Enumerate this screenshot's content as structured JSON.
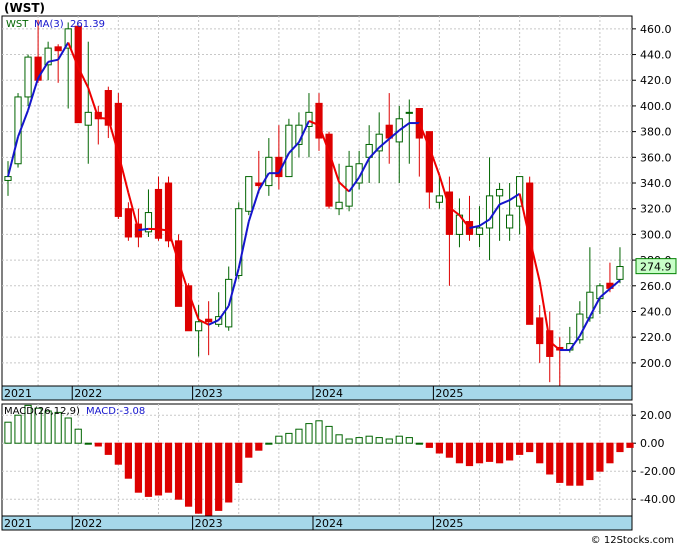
{
  "header": {
    "title": "(WST)"
  },
  "footer": {
    "credit": "© 12Stocks.com"
  },
  "colors": {
    "up": "#006400",
    "down": "#dd0000",
    "ma": "#1515cc",
    "ma_red": "#ee0000",
    "axis_band": "#a6d8ea",
    "grid": "#c8c8c8",
    "price_box": "#c8ffc8"
  },
  "chart_data": [
    {
      "type": "candlestick",
      "legend": {
        "ticker": "WST",
        "ma_label": "MA(3)",
        "ma_value": "261.39"
      },
      "last_price": "274.9",
      "ylim": [
        182,
        470
      ],
      "yticks": [
        "460.0",
        "440.0",
        "420.0",
        "400.0",
        "380.0",
        "360.0",
        "340.0",
        "320.0",
        "300.0",
        "280.0",
        "260.0",
        "240.0",
        "220.0",
        "200.0"
      ],
      "x_years": [
        {
          "label": "2021",
          "index": 0
        },
        {
          "label": "2022",
          "index": 7
        },
        {
          "label": "2023",
          "index": 19
        },
        {
          "label": "2024",
          "index": 31
        },
        {
          "label": "2025",
          "index": 43
        }
      ],
      "grid": true,
      "candles": [
        [
          342,
          357,
          330,
          345
        ],
        [
          355,
          410,
          352,
          407
        ],
        [
          407,
          440,
          400,
          438
        ],
        [
          438,
          467,
          418,
          420
        ],
        [
          432,
          450,
          420,
          445
        ],
        [
          446,
          448,
          418,
          443
        ],
        [
          445,
          465,
          398,
          460
        ],
        [
          462,
          462,
          395,
          387
        ],
        [
          385,
          450,
          355,
          395
        ],
        [
          395,
          400,
          370,
          390
        ],
        [
          412,
          415,
          375,
          385
        ],
        [
          402,
          410,
          312,
          314
        ],
        [
          320,
          325,
          295,
          298
        ],
        [
          308,
          320,
          290,
          298
        ],
        [
          302,
          335,
          298,
          317
        ],
        [
          335,
          345,
          295,
          297
        ],
        [
          340,
          345,
          290,
          295
        ],
        [
          295,
          300,
          245,
          244
        ],
        [
          260,
          262,
          225,
          225
        ],
        [
          225,
          245,
          205,
          232
        ],
        [
          234,
          248,
          206,
          232
        ],
        [
          230,
          255,
          228,
          236
        ],
        [
          228,
          275,
          225,
          265
        ],
        [
          268,
          325,
          265,
          320
        ],
        [
          318,
          345,
          315,
          345
        ],
        [
          340,
          365,
          332,
          338
        ],
        [
          338,
          375,
          330,
          360
        ],
        [
          360,
          385,
          335,
          345
        ],
        [
          345,
          390,
          345,
          385
        ],
        [
          370,
          395,
          360,
          385
        ],
        [
          384,
          410,
          360,
          395
        ],
        [
          402,
          410,
          365,
          375
        ],
        [
          378,
          380,
          320,
          322
        ],
        [
          320,
          355,
          315,
          325
        ],
        [
          322,
          365,
          318,
          353
        ],
        [
          340,
          365,
          335,
          355
        ],
        [
          360,
          385,
          340,
          370
        ],
        [
          365,
          395,
          340,
          378
        ],
        [
          385,
          410,
          355,
          375
        ],
        [
          372,
          400,
          340,
          390
        ],
        [
          395,
          405,
          355,
          395
        ],
        [
          398,
          395,
          345,
          375
        ],
        [
          380,
          365,
          320,
          333
        ],
        [
          325,
          345,
          320,
          330
        ],
        [
          333,
          345,
          260,
          300
        ],
        [
          300,
          328,
          290,
          315
        ],
        [
          310,
          330,
          295,
          300
        ],
        [
          300,
          322,
          290,
          305
        ],
        [
          305,
          360,
          280,
          330
        ],
        [
          330,
          340,
          295,
          335
        ],
        [
          305,
          340,
          295,
          315
        ],
        [
          322,
          338,
          300,
          345
        ],
        [
          340,
          345,
          240,
          230
        ],
        [
          235,
          245,
          200,
          215
        ],
        [
          225,
          240,
          185,
          205
        ],
        [
          212,
          220,
          180,
          210
        ],
        [
          210,
          228,
          208,
          215
        ],
        [
          218,
          248,
          215,
          238
        ],
        [
          235,
          290,
          232,
          255
        ],
        [
          250,
          262,
          238,
          260
        ],
        [
          262,
          278,
          255,
          258
        ],
        [
          265,
          290,
          262,
          275
        ]
      ],
      "ma_blue": [
        [
          0,
          340
        ],
        [
          1,
          380
        ],
        [
          2,
          410
        ],
        [
          3,
          428
        ],
        [
          4,
          440
        ],
        [
          5,
          445
        ],
        [
          6,
          448
        ],
        [
          7,
          440
        ],
        [
          8,
          415
        ],
        [
          9,
          400
        ]
      ],
      "ma_red": [
        [
          9,
          400
        ],
        [
          10,
          390
        ],
        [
          11,
          350
        ],
        [
          12,
          315
        ],
        [
          13,
          308
        ],
        [
          14,
          305
        ]
      ],
      "ma_blue_2": [
        [
          14,
          305
        ],
        [
          15,
          300
        ],
        [
          16,
          285
        ],
        [
          17,
          262
        ],
        [
          18,
          242
        ]
      ],
      "ma_red_2": [
        [
          18,
          242
        ],
        [
          19,
          233
        ],
        [
          20,
          232
        ]
      ]
    },
    {
      "type": "bar",
      "legend": {
        "label": "MACD(26,12,9)",
        "value_label": "MACD:-3.08"
      },
      "ylim": [
        -52,
        28
      ],
      "yticks": [
        "20.00",
        "0.00",
        "-20.00",
        "-40.00"
      ],
      "values": [
        15,
        20,
        27,
        25,
        23,
        22,
        18,
        10,
        0,
        -2,
        -8,
        -15,
        -25,
        -35,
        -38,
        -37,
        -35,
        -40,
        -45,
        -50,
        -52,
        -48,
        -42,
        -28,
        -10,
        -5,
        0,
        5,
        7,
        10,
        14,
        16,
        12,
        6,
        3,
        4,
        5,
        4,
        3,
        5,
        4,
        0,
        -3,
        -7,
        -10,
        -14,
        -16,
        -14,
        -13,
        -14,
        -12,
        -8,
        -6,
        -14,
        -22,
        -28,
        -30,
        -30,
        -26,
        -20,
        -14,
        -6,
        -3
      ]
    }
  ]
}
